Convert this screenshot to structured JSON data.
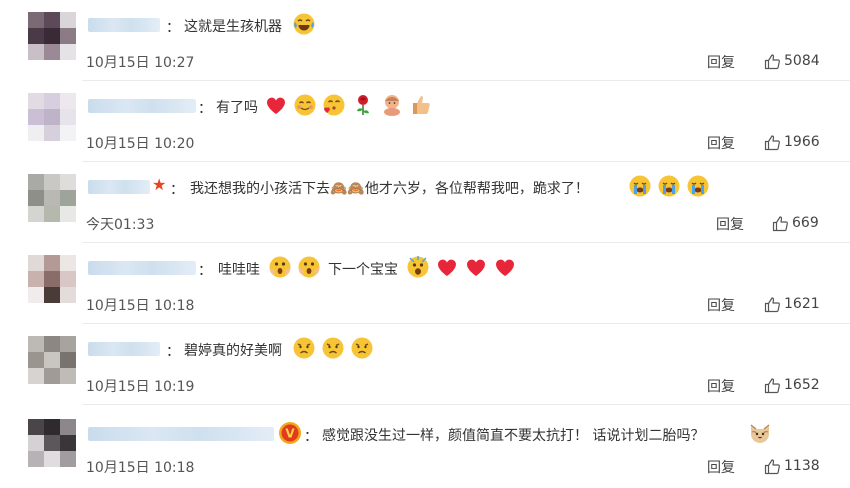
{
  "comments": [
    {
      "text": "这就是生孩机器",
      "time": "10月15日 10:27",
      "reply": "回复",
      "likes": "5084",
      "emojis": [
        "laugh-cry-emoji"
      ]
    },
    {
      "text": "有了吗",
      "time": "10月15日 10:20",
      "reply": "回复",
      "likes": "1966",
      "emojis": [
        "heart-emoji",
        "blush-emoji",
        "kiss-emoji",
        "rose-emoji",
        "baby-emoji",
        "thumbs-up-emoji"
      ]
    },
    {
      "text": "我还想我的小孩活下去🙈🙈他才六岁，各位帮帮我吧，跪求了！",
      "time": "今天01:33",
      "reply": "回复",
      "likes": "669",
      "badge": "★",
      "emojis": [
        "crying-emoji",
        "crying-emoji",
        "crying-emoji"
      ]
    },
    {
      "text": "哇哇哇",
      "text2": "下一个宝宝",
      "time": "10月15日 10:18",
      "reply": "回复",
      "likes": "1621",
      "emojis": [
        "shocked-emoji",
        "shocked-emoji"
      ],
      "emojis2": [
        "scream-emoji",
        "heart-emoji",
        "heart-emoji",
        "heart-emoji"
      ]
    },
    {
      "text": "碧婷真的好美啊",
      "time": "10月15日 10:19",
      "reply": "回复",
      "likes": "1652",
      "emojis": [
        "sad-emoji",
        "sad-emoji",
        "sad-emoji"
      ]
    },
    {
      "text": "感觉跟没生过一样，颜值简直不要太抗打！ 话说计划二胎吗？",
      "time": "10月15日 10:18",
      "reply": "回复",
      "likes": "1138",
      "badge": "V",
      "emojis": [
        "cat-emoji"
      ]
    }
  ],
  "colors": {
    "accent_red": "#e8431c",
    "heart": "#e8263a",
    "emoji_yellow": "#f7c436",
    "name_blur": "#cfe0ee"
  }
}
